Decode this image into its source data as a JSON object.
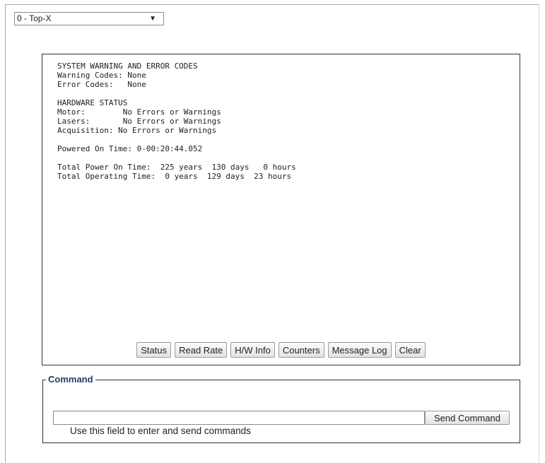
{
  "device_select": {
    "selected": "0 - Top-X"
  },
  "status_panel": {
    "lines": [
      "SYSTEM WARNING AND ERROR CODES",
      "Warning Codes: None",
      "Error Codes:   None",
      "",
      "HARDWARE STATUS",
      "Motor:        No Errors or Warnings",
      "Lasers:       No Errors or Warnings",
      "Acquisition: No Errors or Warnings",
      "",
      "Powered On Time: 0-00:20:44.052",
      "",
      "Total Power On Time:  225 years  130 days   0 hours",
      "Total Operating Time:  0 years  129 days  23 hours"
    ],
    "buttons": {
      "status": "Status",
      "read_rate": "Read Rate",
      "hw_info": "H/W Info",
      "counters": "Counters",
      "message_log": "Message Log",
      "clear": "Clear"
    }
  },
  "command": {
    "legend": "Command",
    "input_value": "",
    "send_label": "Send Command",
    "helper": "Use this field to enter and send commands"
  }
}
